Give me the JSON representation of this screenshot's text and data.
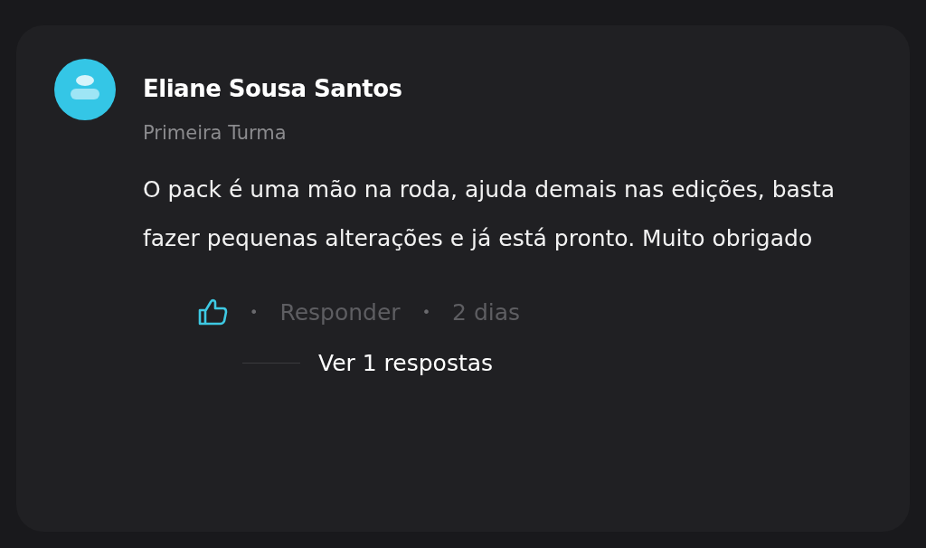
{
  "comment": {
    "author": "Eliane Sousa Santos",
    "group": "Primeira Turma",
    "text": "O pack é uma mão na roda, ajuda demais nas edições, basta fazer pequenas alterações e já está pronto. Muito obrigado",
    "actions": {
      "separator_1": "•",
      "reply": "Responder",
      "separator_2": "•",
      "time": "2 dias"
    },
    "replies_link": "Ver 1 respostas"
  }
}
